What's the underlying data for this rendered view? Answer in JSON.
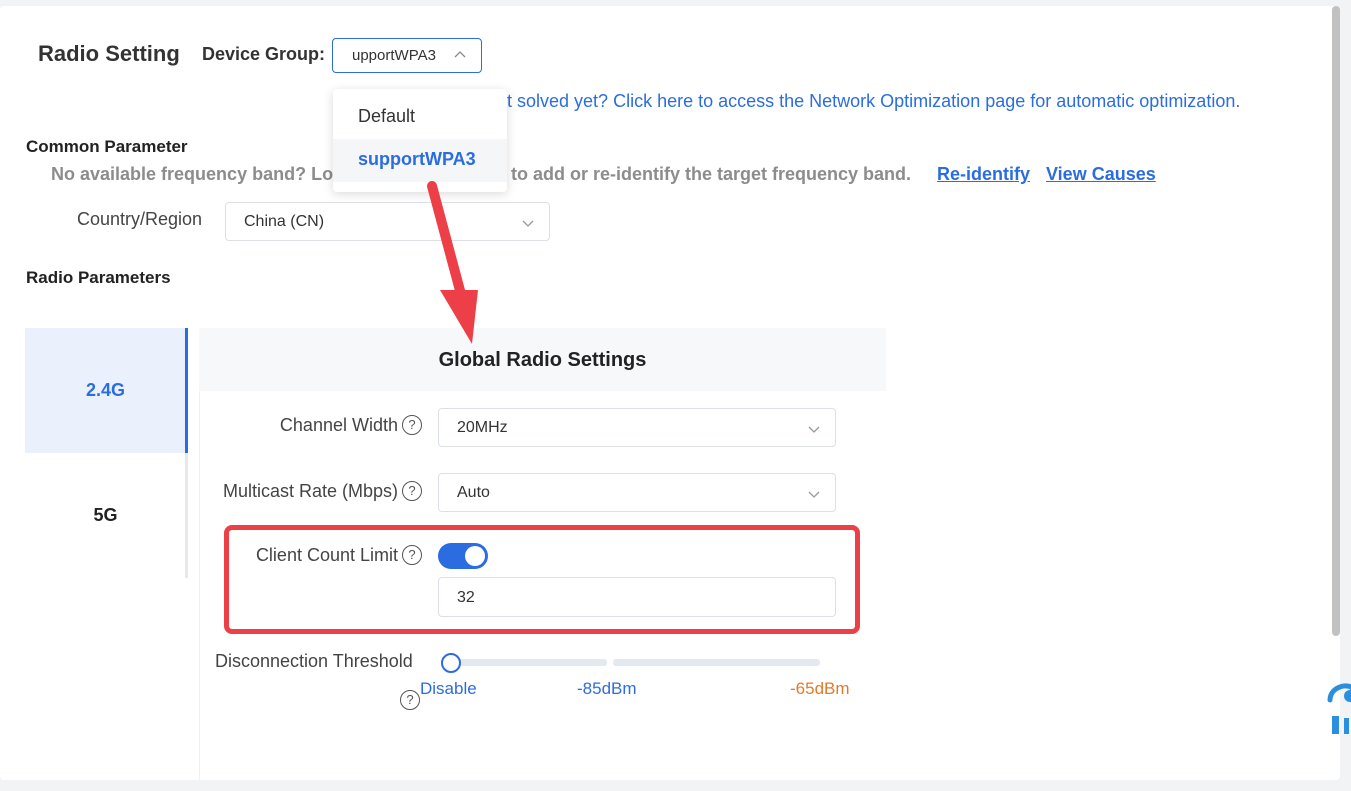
{
  "page": {
    "title": "Radio Setting",
    "device_group_label": "Device Group:",
    "device_group_value": "upportWPA3"
  },
  "dropdown": {
    "options": [
      "Default",
      "supportWPA3"
    ],
    "selected": "supportWPA3"
  },
  "hint": {
    "link_text": "ot solved yet? Click here to access the Network Optimization page for automatic optimization."
  },
  "common": {
    "title": "Common Parameter",
    "noband_text_a": "No available frequency band? Lo",
    "noband_text_b": "to add or re-identify the target frequency band.",
    "reidentify_link": "Re-identify",
    "view_causes_link": "View Causes",
    "country_label": "Country/Region",
    "country_value": "China (CN)"
  },
  "radio": {
    "title": "Radio Parameters",
    "tabs": [
      {
        "label": "2.4G",
        "active": true
      },
      {
        "label": "5G",
        "active": false
      }
    ],
    "panel_title": "Global Radio Settings",
    "channel_width_label": "Channel Width",
    "channel_width_value": "20MHz",
    "multicast_label": "Multicast Rate (Mbps)",
    "multicast_value": "Auto",
    "client_limit_label": "Client Count Limit",
    "client_limit_enabled": true,
    "client_limit_value": "32",
    "disconnect_label": "Disconnection Threshold",
    "slider_marks": [
      "Disable",
      "-85dBm",
      "-65dBm"
    ],
    "slider_value": "Disable"
  },
  "icons": {
    "help": "question-circle-icon",
    "chevron": "chevron-down-icon",
    "chevron_up": "chevron-up-icon"
  },
  "colors": {
    "accent": "#2b6de0",
    "highlight": "#ec3f47",
    "warning_mark": "#e07b2b"
  }
}
